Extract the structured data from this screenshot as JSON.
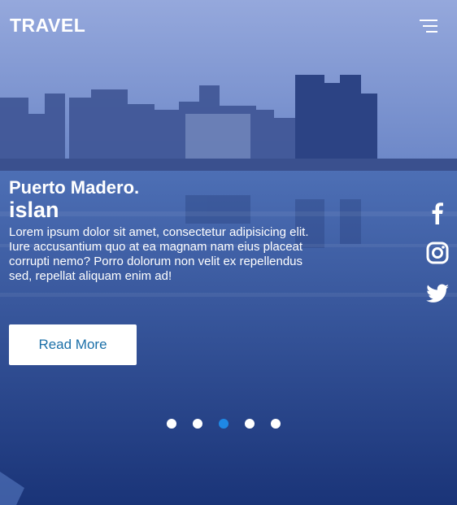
{
  "header": {
    "brand": "TRAVEL",
    "menu_icon": "hamburger-menu-icon"
  },
  "slide": {
    "title": "Puerto Madero.",
    "subtitle": "islan",
    "description": "Lorem ipsum dolor sit amet, consectetur adipisicing elit. Iure accusantium quo at ea magnam nam eius placeat corrupti nemo? Porro dolorum non velit ex repellendus sed, repellat aliquam enim ad!",
    "button_label": "Read More"
  },
  "social": [
    {
      "name": "facebook-icon"
    },
    {
      "name": "instagram-icon"
    },
    {
      "name": "twitter-icon"
    }
  ],
  "carousel": {
    "count": 5,
    "active_index": 2
  },
  "colors": {
    "active_dot": "#1e88e5",
    "button_text": "#1a6fa8",
    "text": "#ffffff"
  }
}
